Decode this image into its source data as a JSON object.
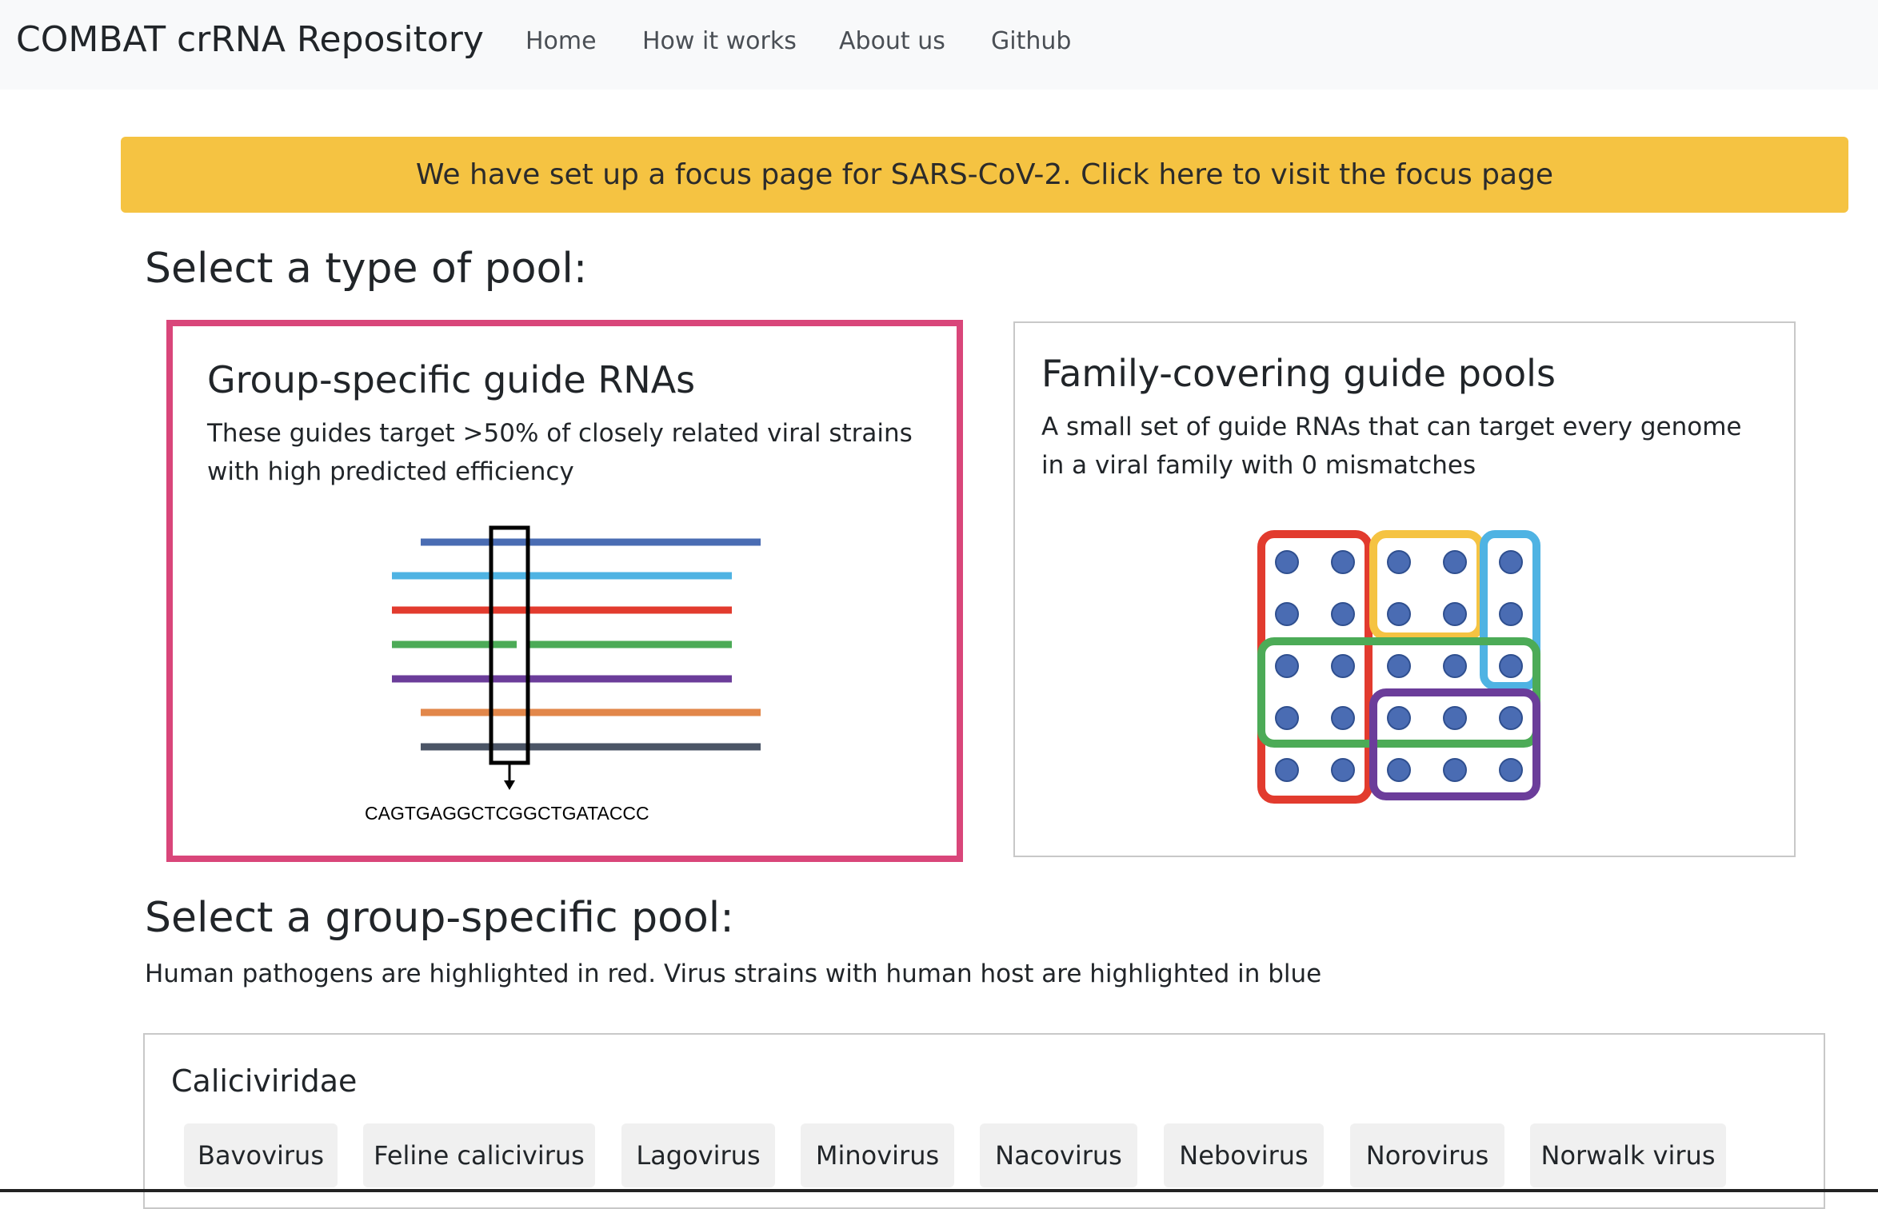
{
  "navbar": {
    "brand": "COMBAT crRNA Repository",
    "links": [
      "Home",
      "How it works",
      "About us",
      "Github"
    ]
  },
  "banner": {
    "text": "We have set up a focus page for SARS-CoV-2. Click here to visit the focus page"
  },
  "pool_section": {
    "title": "Select a type of pool:",
    "cards": [
      {
        "title": "Group-specific guide RNAs",
        "description": "These guides target >50% of closely related viral strains with high predicted efficiency",
        "sequence": "CAGTGAGGCTCGGCTGATACCC",
        "selected": true
      },
      {
        "title": "Family-covering guide pools",
        "description": "A small set of guide RNAs that can target every genome in a viral family with 0 mismatches",
        "selected": false
      }
    ]
  },
  "group_section": {
    "title": "Select a group-specific pool:",
    "note": "Human pathogens are highlighted in red. Virus strains with human host are highlighted in blue"
  },
  "family": {
    "name": "Caliciviridae",
    "chips": [
      "Bavovirus",
      "Feline calicivirus",
      "Lagovirus",
      "Minovirus",
      "Nacovirus",
      "Nebovirus",
      "Norovirus",
      "Norwalk virus"
    ]
  },
  "colors": {
    "banner": "#f5c342",
    "selected_border": "#d9467a",
    "navbar_bg": "#f8f9fa",
    "chip_bg": "#f0f0f0"
  }
}
